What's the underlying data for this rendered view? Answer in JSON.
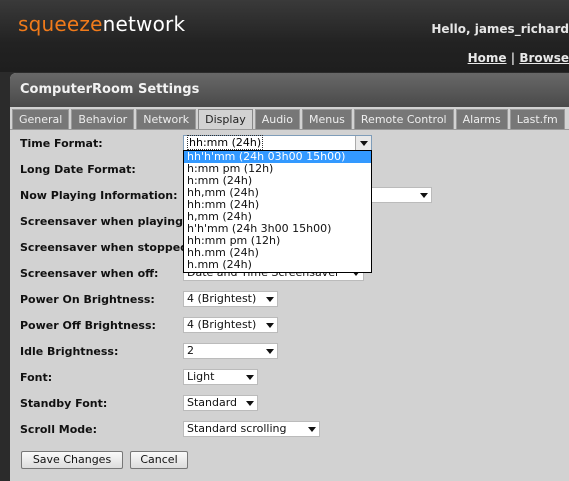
{
  "header": {
    "logo_part1": "squeeze",
    "logo_part2": "network",
    "greeting": "Hello, james_richard",
    "nav_home": "Home",
    "nav_separator": "|",
    "nav_browse": "Browse"
  },
  "panel": {
    "title": "ComputerRoom Settings"
  },
  "tabs": [
    "General",
    "Behavior",
    "Network",
    "Display",
    "Audio",
    "Menus",
    "Remote Control",
    "Alarms",
    "Last.fm"
  ],
  "active_tab": "Display",
  "fields": {
    "time_format": {
      "label": "Time Format:",
      "value": "hh:mm (24h)"
    },
    "long_date_format": {
      "label": "Long Date Format:"
    },
    "now_playing": {
      "label": "Now Playing Information:"
    },
    "screensaver_playing": {
      "label": "Screensaver when playing:"
    },
    "screensaver_stopped": {
      "label": "Screensaver when stopped:"
    },
    "screensaver_off": {
      "label": "Screensaver when off:",
      "value": "Date and Time Screensaver"
    },
    "power_on_brightness": {
      "label": "Power On Brightness:",
      "value": "4 (Brightest)"
    },
    "power_off_brightness": {
      "label": "Power Off Brightness:",
      "value": "4 (Brightest)"
    },
    "idle_brightness": {
      "label": "Idle Brightness:",
      "value": "2"
    },
    "font": {
      "label": "Font:",
      "value": "Light"
    },
    "standby_font": {
      "label": "Standby Font:",
      "value": "Standard"
    },
    "scroll_mode": {
      "label": "Scroll Mode:",
      "value": "Standard scrolling"
    }
  },
  "time_format_options": [
    "hh'h'mm (24h 03h00 15h00)",
    "h:mm pm (12h)",
    "h:mm (24h)",
    "hh,mm (24h)",
    "hh:mm (24h)",
    "h,mm (24h)",
    "h'h'mm (24h 3h00 15h00)",
    "hh:mm pm (12h)",
    "hh.mm (24h)",
    "h.mm (24h)"
  ],
  "buttons": {
    "save": "Save Changes",
    "cancel": "Cancel"
  },
  "colors": {
    "brand_orange": "#f07a1a",
    "selection": "#3399ff"
  }
}
